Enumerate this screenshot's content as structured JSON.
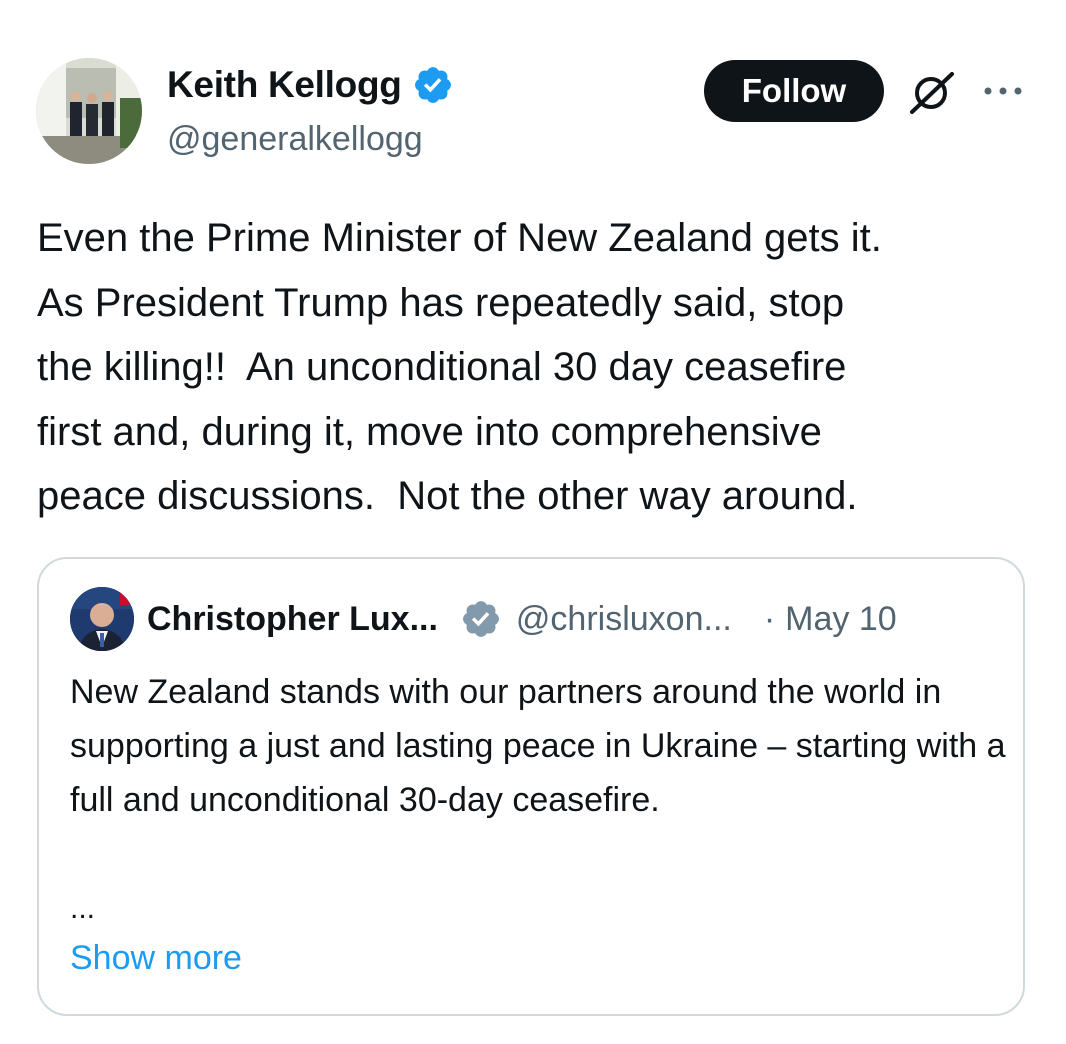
{
  "author": {
    "name": "Keith Kellogg",
    "handle": "@generalkellogg",
    "verified_icon": "verified-badge-icon",
    "badge_color": "#1d9bf0"
  },
  "actions": {
    "follow_label": "Follow",
    "grok_icon": "grok-icon",
    "more_icon": "more-options-icon"
  },
  "tweet": {
    "text": "Even the Prime Minister of New Zealand gets it.\nAs President Trump has repeatedly said, stop\nthe killing!!  An unconditional 30 day ceasefire\nfirst and, during it, move into comprehensive\npeace discussions.  Not the other way around."
  },
  "quote": {
    "name": "Christopher Lux...",
    "handle": "@chrisluxon...",
    "separator": "·",
    "date": "May 10",
    "badge_color": "#829aab",
    "text": "New Zealand stands with our partners around the world in supporting a just and lasting peace in Ukraine – starting with a full and unconditional 30-day ceasefire.",
    "ellipsis": "...",
    "show_more": "Show more",
    "link_color": "#1d9bf0"
  }
}
